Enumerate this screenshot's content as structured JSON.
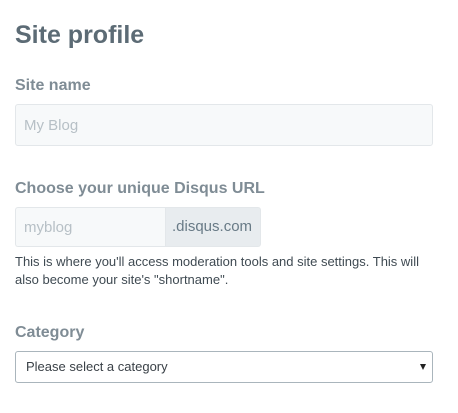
{
  "page": {
    "title": "Site profile"
  },
  "site_name": {
    "label": "Site name",
    "placeholder": "My Blog",
    "value": ""
  },
  "disqus_url": {
    "label": "Choose your unique Disqus URL",
    "placeholder": "myblog",
    "value": "",
    "suffix": ".disqus.com",
    "help_text": "This is where you'll access moderation tools and site settings. This will also become your site's \"shortname\"."
  },
  "category": {
    "label": "Category",
    "selected": "Please select a category"
  },
  "colors": {
    "title": "#5c6b75",
    "label": "#7f8c95",
    "input_background": "#f7f9fa",
    "suffix_background": "#e8ecef",
    "help_text": "#3f4a52"
  },
  "icons": {
    "select_arrow": "chevron-down-icon"
  }
}
